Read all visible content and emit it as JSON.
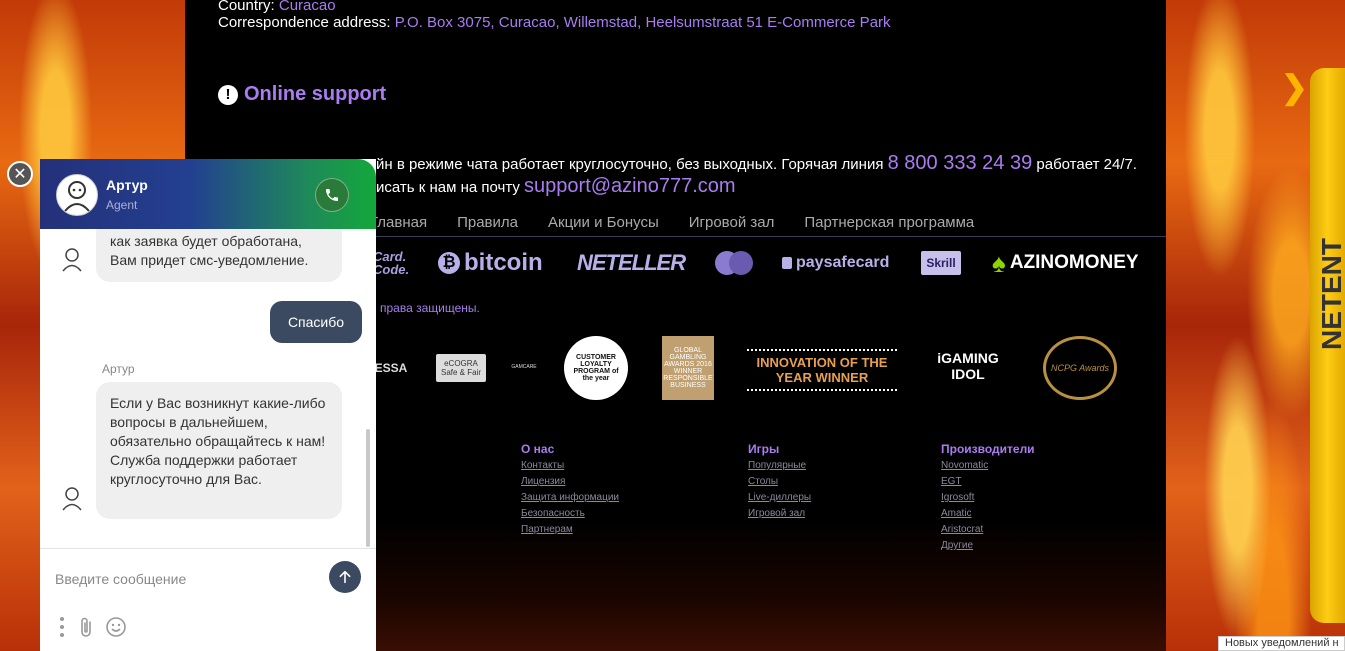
{
  "site": {
    "country_label": "Country:",
    "country_value": "Curacao",
    "address_label": "Correspondence address:",
    "address_value": "P.O. Box 3075, Curacao, Willemstad, Heelsumstraat 51 E-Commerce Park",
    "support_title": "Online support",
    "support_text_1": "Поддержка онлайн в режиме чата работает круглосуточно, без выходных. Горячая линия",
    "support_text_1_visible": "йн в режиме чата работает круглосуточно, без выходных. Горячая линия",
    "phone": "8 800 333 24 39",
    "works": "работает 24/7.",
    "mail_prefix": "исать к нам на почту",
    "email": "support@azino777.com",
    "nav": [
      "Главная",
      "Правила",
      "Акции и Бонусы",
      "Игровой зал",
      "Партнерская программа"
    ],
    "payments": [
      "Card. Code.",
      "bitcoin",
      "NETELLER",
      "mastercard",
      "paysafecard",
      "Skrill",
      "AZINOMONEY"
    ],
    "rights": "права защищены.",
    "awards": [
      "ESSA",
      "eCOGRA Safe & Fair",
      "GAMCARE",
      "CUSTOMER LOYALTY PROGRAM of the year",
      "GLOBAL GAMBLING AWARDS 2016 WINNER RESPONSIBLE BUSINESS",
      "INNOVATION OF THE YEAR WINNER",
      "iGAMING IDOL",
      "NCPG Awards"
    ],
    "footer_cols": [
      {
        "title": "О нас",
        "links": [
          "Контакты",
          "Лицензия",
          "Защита информации",
          "Безопасность",
          "Партнерам"
        ]
      },
      {
        "title": "Игры",
        "links": [
          "Популярные",
          "Столы",
          "Live-диллеры",
          "Игровой зал"
        ]
      },
      {
        "title": "Производители",
        "links": [
          "Novomatic",
          "EGT",
          "Igrosoft",
          "Amatic",
          "Aristocrat",
          "Другие"
        ]
      }
    ],
    "side_banner": "NETENT",
    "notification": "Новых уведомлений н"
  },
  "chat": {
    "agent_name": "Артур",
    "agent_role": "Agent",
    "messages": {
      "agent_1": "как заявка будет обработана, Вам придет смс-уведомление.",
      "user_1": "Спасибо",
      "sender": "Артур",
      "agent_2": "Если у Вас возникнут какие-либо вопросы в дальнейшем, обязательно обращайтесь к нам! Служба поддержки работает круглосуточно для Вас."
    },
    "input_placeholder": "Введите сообщение"
  },
  "colors": {
    "accent_purple": "#a97cf0",
    "chat_header_start": "#24307a",
    "chat_header_end": "#13a83a",
    "user_bubble": "#3b4a60"
  }
}
